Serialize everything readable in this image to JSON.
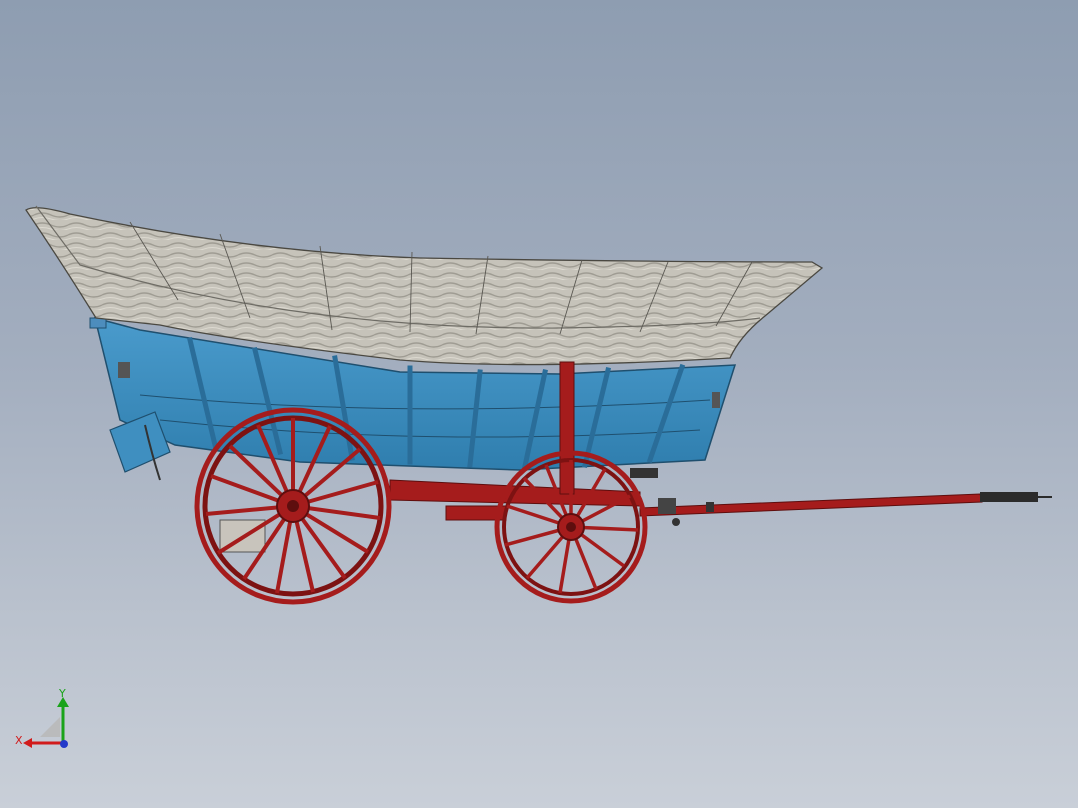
{
  "viewport": {
    "background_top": "#8e9db1",
    "background_bottom": "#c9cfd8"
  },
  "model": {
    "canopy_color": "#c9c6bd",
    "body_color": "#3f8fc0",
    "running_gear_color": "#a51c1c",
    "metal_color": "#3a3a3a"
  },
  "triad": {
    "y_label": "Y",
    "x_label": "X",
    "y_color": "#1aa31a",
    "x_color": "#d11b1b",
    "z_color": "#2339c9"
  }
}
